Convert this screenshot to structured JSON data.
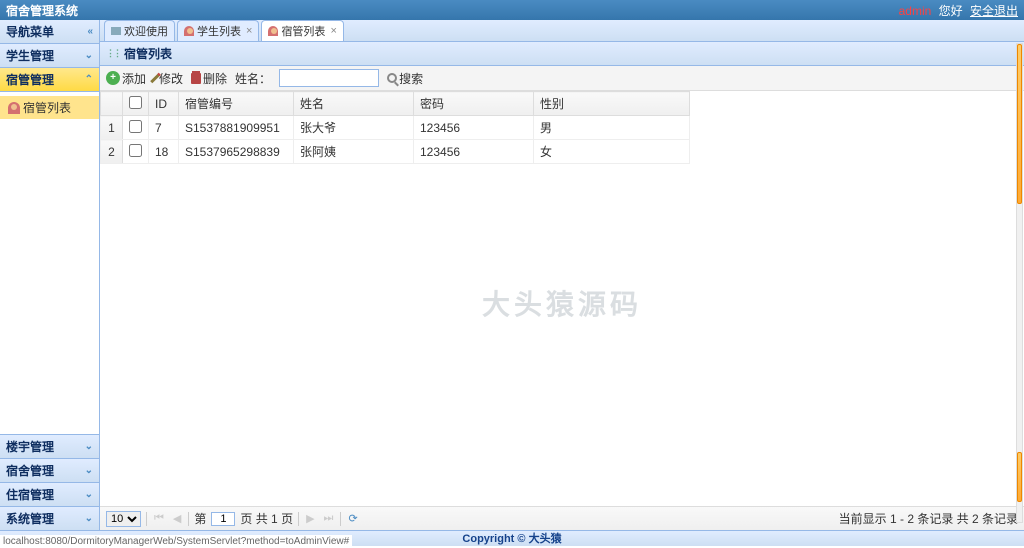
{
  "header": {
    "title": "宿舍管理系统",
    "user": "admin",
    "greeting": "您好",
    "logout": "安全退出"
  },
  "sidebar": {
    "title": "导航菜单",
    "items": [
      {
        "label": "学生管理"
      },
      {
        "label": "宿管管理"
      },
      {
        "label": "楼宇管理"
      },
      {
        "label": "宿舍管理"
      },
      {
        "label": "住宿管理"
      },
      {
        "label": "系统管理"
      }
    ],
    "tree_item": "宿管列表"
  },
  "tabs": [
    {
      "label": "欢迎使用"
    },
    {
      "label": "学生列表"
    },
    {
      "label": "宿管列表"
    }
  ],
  "panel": {
    "title": "宿管列表"
  },
  "toolbar": {
    "add": "添加",
    "edit": "修改",
    "del": "删除",
    "name_label": "姓名：",
    "search": "搜索"
  },
  "columns": {
    "id": "ID",
    "num": "宿管编号",
    "name": "姓名",
    "pwd": "密码",
    "gender": "性别"
  },
  "rows": [
    {
      "idx": "1",
      "id": "7",
      "num": "S1537881909951",
      "name": "张大爷",
      "pwd": "123456",
      "gender": "男"
    },
    {
      "idx": "2",
      "id": "18",
      "num": "S1537965298839",
      "name": "张阿姨",
      "pwd": "123456",
      "gender": "女"
    }
  ],
  "pagination": {
    "page_size": "10",
    "page_prefix": "第",
    "page": "1",
    "page_suffix": "页 共 1 页",
    "info": "当前显示 1 - 2 条记录 共 2 条记录"
  },
  "watermark": "大头猿源码",
  "footer": {
    "copyright": "Copyright ©",
    "brand": "大头猿"
  },
  "status_url": "localhost:8080/DormitoryManagerWeb/SystemServlet?method=toAdminView#"
}
